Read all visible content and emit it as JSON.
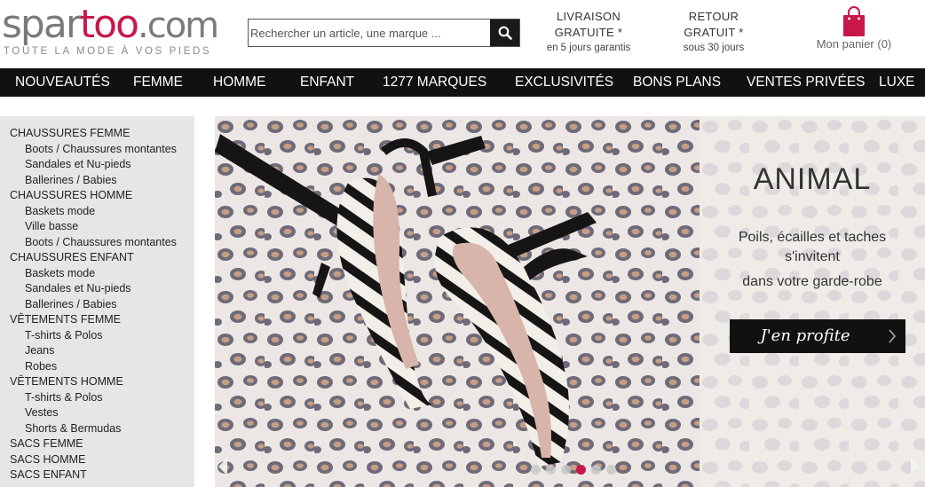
{
  "header": {
    "logo": {
      "spar": "spar",
      "too": "too",
      "com": ".com",
      "tagline": "TOUTE LA MODE À VOS PIEDS"
    },
    "search": {
      "placeholder": "Rechercher un article, une marque ..."
    },
    "livraison": {
      "line1": "LIVRAISON",
      "line2": "GRATUITE *",
      "line3": "en 5 jours garantis"
    },
    "retour": {
      "line1": "RETOUR",
      "line2": "GRATUIT *",
      "line3": "sous 30 jours"
    },
    "cart": {
      "label": "Mon panier (0)"
    }
  },
  "nav": {
    "items": [
      "NOUVEAUTÉS",
      "FEMME",
      "HOMME",
      "ENFANT",
      "1277 MARQUES",
      "EXCLUSIVITÉS",
      "BONS PLANS",
      "VENTES PRIVÉES",
      "LUXE"
    ]
  },
  "sidebar": {
    "rows": [
      {
        "label": "CHAUSSURES FEMME",
        "type": "cat"
      },
      {
        "label": "Boots / Chaussures montantes",
        "type": "sub"
      },
      {
        "label": "Sandales et Nu-pieds",
        "type": "sub"
      },
      {
        "label": "Ballerines / Babies",
        "type": "sub"
      },
      {
        "label": "CHAUSSURES HOMME",
        "type": "cat"
      },
      {
        "label": "Baskets mode",
        "type": "sub"
      },
      {
        "label": "Ville basse",
        "type": "sub"
      },
      {
        "label": "Boots / Chaussures montantes",
        "type": "sub"
      },
      {
        "label": "CHAUSSURES ENFANT",
        "type": "cat"
      },
      {
        "label": "Baskets mode",
        "type": "sub"
      },
      {
        "label": "Sandales et Nu-pieds",
        "type": "sub"
      },
      {
        "label": "Ballerines / Babies",
        "type": "sub"
      },
      {
        "label": "VÊTEMENTS FEMME",
        "type": "cat"
      },
      {
        "label": "T-shirts & Polos",
        "type": "sub"
      },
      {
        "label": "Jeans",
        "type": "sub"
      },
      {
        "label": "Robes",
        "type": "sub"
      },
      {
        "label": "VÊTEMENTS HOMME",
        "type": "cat"
      },
      {
        "label": "T-shirts & Polos",
        "type": "sub"
      },
      {
        "label": "Vestes",
        "type": "sub"
      },
      {
        "label": "Shorts & Bermudas",
        "type": "sub"
      },
      {
        "label": "SACS FEMME",
        "type": "cat"
      },
      {
        "label": "SACS HOMME",
        "type": "cat"
      },
      {
        "label": "SACS ENFANT",
        "type": "cat"
      }
    ]
  },
  "banner": {
    "title": "ANIMAL",
    "sub1": "Poils, écailles et taches",
    "sub2": "s'invitent",
    "sub3": "dans votre garde-robe",
    "cta": "J'en profite",
    "active_slide": 3,
    "slide_count": 6
  },
  "colors": {
    "brand": "#c8184a",
    "nav_bg": "#111111",
    "sidebar_bg": "#e6e6e6"
  },
  "icons": {
    "search": "search-icon",
    "cart": "shopping-bag-icon",
    "prev": "chevron-left-icon",
    "next": "chevron-right-icon"
  }
}
